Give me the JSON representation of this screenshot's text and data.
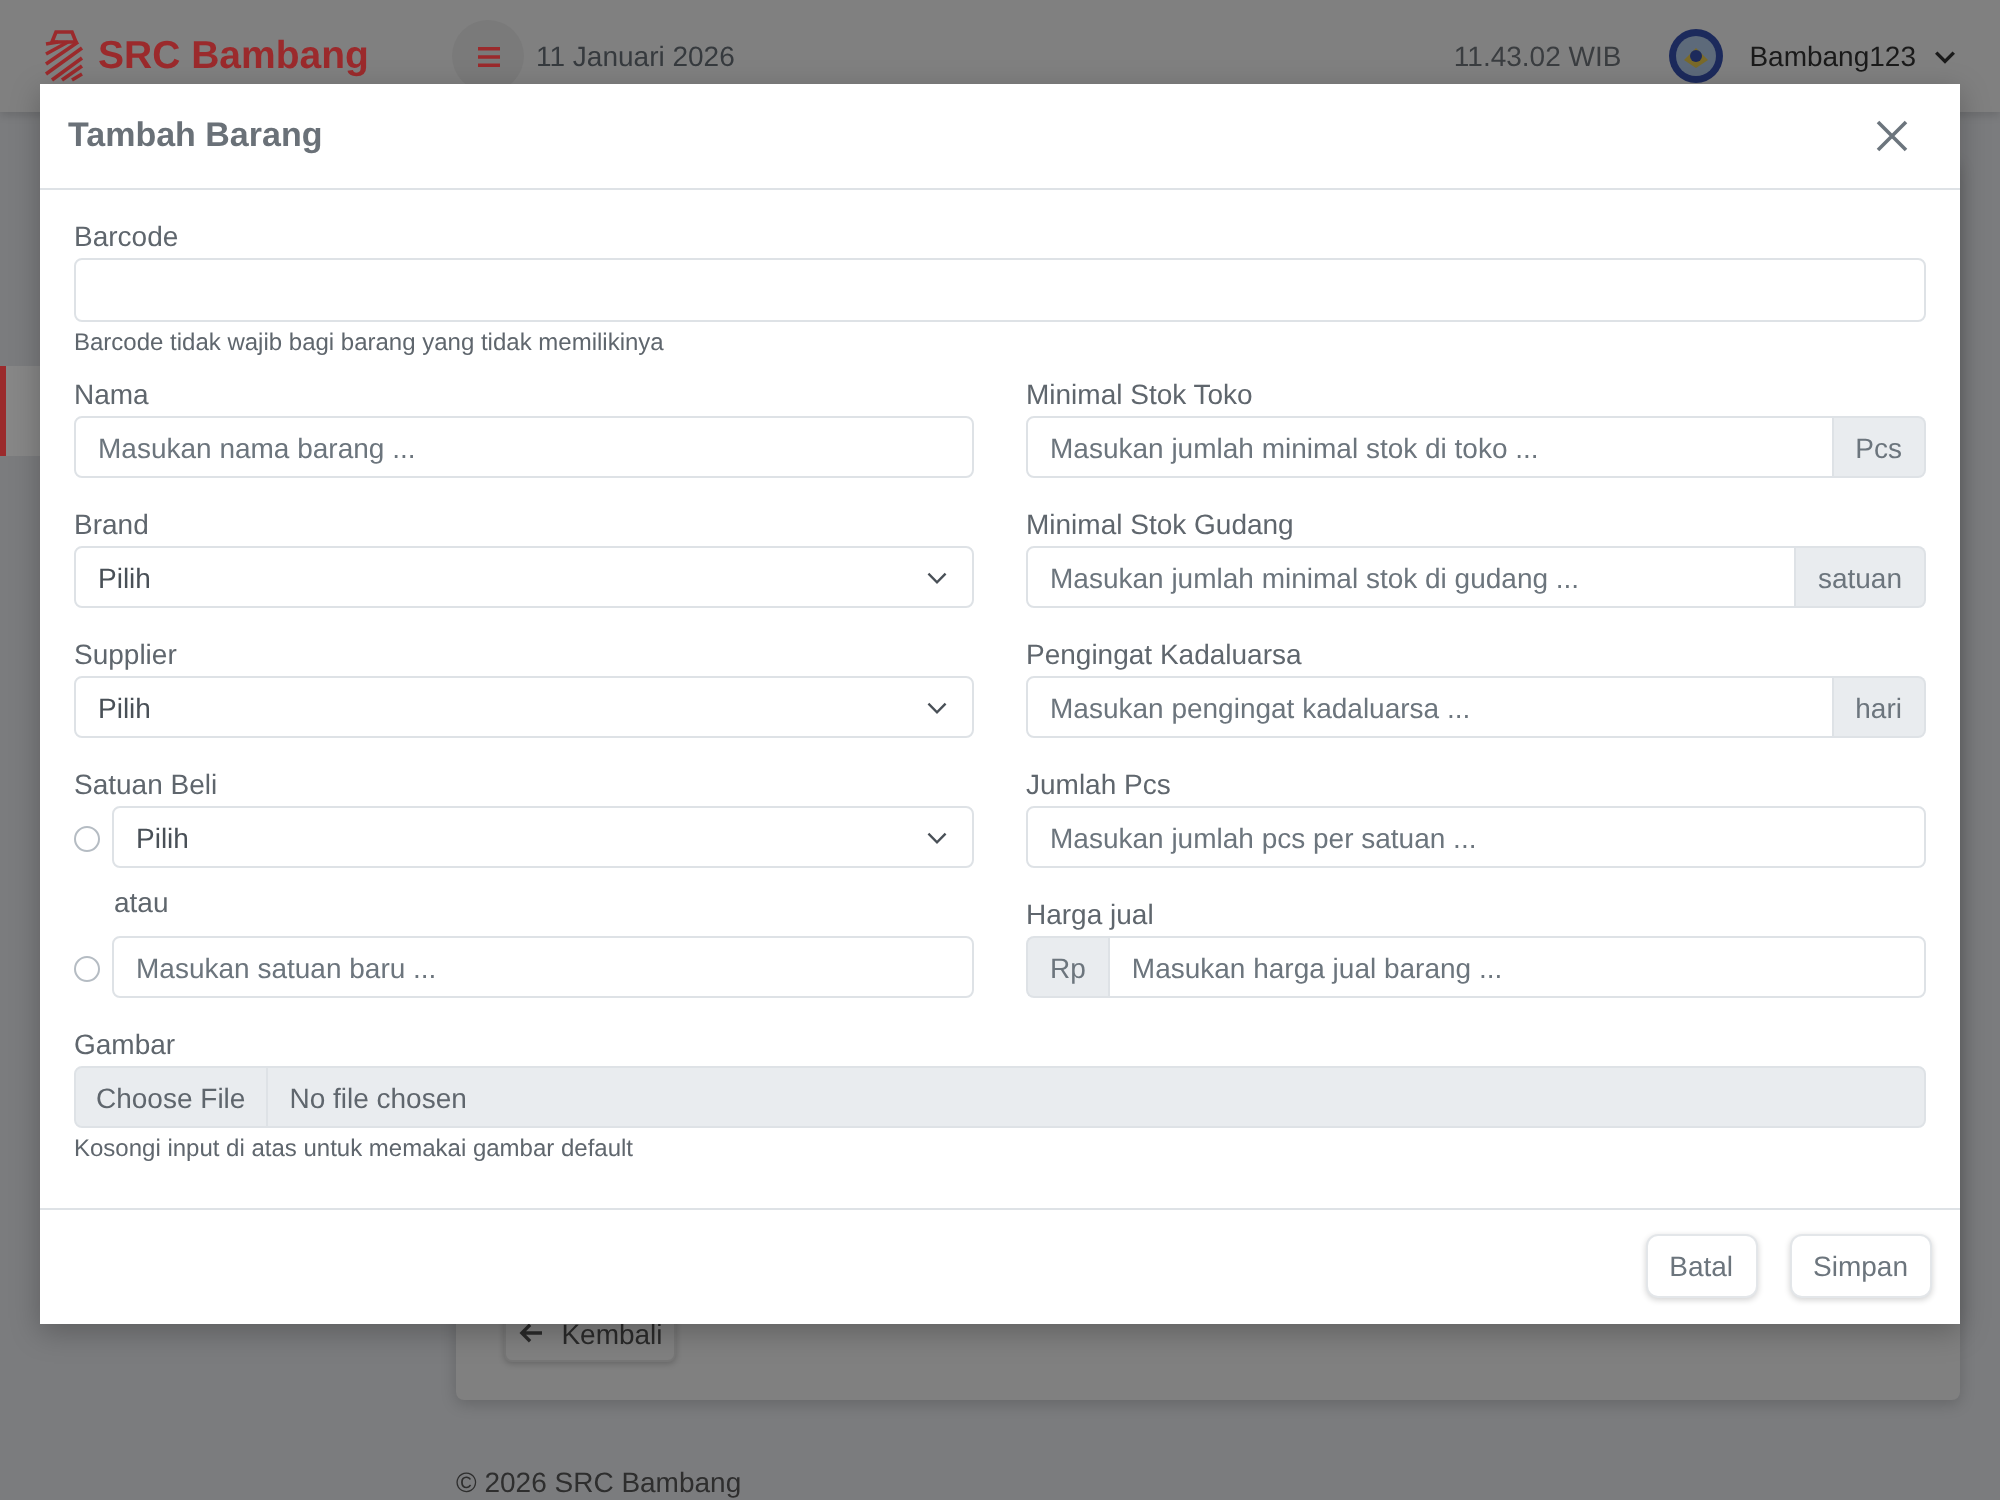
{
  "header": {
    "brand": "SRC Bambang",
    "date": "11 Januari 2026",
    "time": "11.43.02 WIB",
    "user": "Bambang123"
  },
  "sidebar": {
    "items": [
      {
        "selected": true
      }
    ]
  },
  "page": {
    "back_button": "Kembali"
  },
  "footer": {
    "copyright": "© 2026 SRC Bambang"
  },
  "modal": {
    "title": "Tambah Barang",
    "barcode": {
      "kind": "text",
      "label": "Barcode",
      "help": "Barcode tidak wajib bagi barang yang tidak memilikinya"
    },
    "left_fields": [
      {
        "kind": "text",
        "label": "Nama",
        "placeholder": "Masukan nama barang ..."
      },
      {
        "kind": "select",
        "label": "Brand",
        "value": "Pilih"
      },
      {
        "kind": "select",
        "label": "Supplier",
        "value": "Pilih"
      },
      {
        "kind": "choice",
        "label": "Satuan Beli",
        "separator": "atau",
        "options": [
          {
            "kind": "select",
            "value": "Pilih",
            "selected": false
          },
          {
            "kind": "text",
            "placeholder": "Masukan satuan baru ...",
            "selected": false
          }
        ]
      }
    ],
    "right_fields": [
      {
        "kind": "text",
        "label": "Minimal Stok Toko",
        "placeholder": "Masukan jumlah minimal stok di toko ...",
        "suffix": "Pcs"
      },
      {
        "kind": "text",
        "label": "Minimal Stok Gudang",
        "placeholder": "Masukan jumlah minimal stok di gudang ...",
        "suffix": "satuan"
      },
      {
        "kind": "text",
        "label": "Pengingat Kadaluarsa",
        "placeholder": "Masukan pengingat kadaluarsa ...",
        "suffix": "hari"
      },
      {
        "kind": "text",
        "label": "Jumlah Pcs",
        "placeholder": "Masukan jumlah pcs per satuan ..."
      },
      {
        "kind": "text",
        "label": "Harga jual",
        "placeholder": "Masukan harga jual barang ...",
        "prefix": "Rp"
      }
    ],
    "image": {
      "label": "Gambar",
      "button": "Choose File",
      "status": "No file chosen",
      "help": "Kosongi input di atas untuk memakai gambar default"
    },
    "buttons": [
      {
        "label": "Batal"
      },
      {
        "label": "Simpan"
      }
    ]
  }
}
